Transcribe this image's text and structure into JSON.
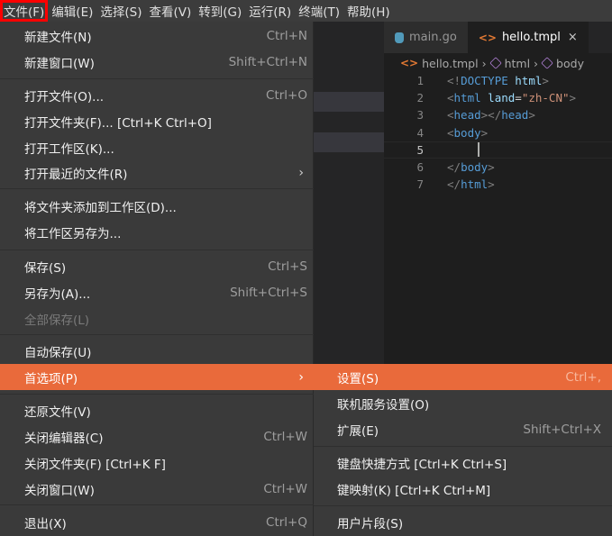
{
  "menubar": {
    "items": [
      "文件(F)",
      "编辑(E)",
      "选择(S)",
      "查看(V)",
      "转到(G)",
      "运行(R)",
      "终端(T)",
      "帮助(H)"
    ]
  },
  "tabs": [
    {
      "label": "main.go",
      "icon": "go-file-icon"
    },
    {
      "label": "hello.tmpl",
      "icon": "tag-file-icon",
      "close": "×"
    }
  ],
  "breadcrumb": {
    "file": "hello.tmpl",
    "html": "html",
    "body": "body"
  },
  "code": {
    "line_numbers": [
      "1",
      "2",
      "3",
      "4",
      "5",
      "6",
      "7"
    ],
    "l1_open": "<!",
    "l1_doctype": "DOCTYPE",
    "l1_sp": " ",
    "l1_html": "html",
    "l1_close": ">",
    "l2_open": "<",
    "l2_tag": "html",
    "l2_sp": " ",
    "l2_attr": "land",
    "l2_eq": "=",
    "l2_val": "\"zh-CN\"",
    "l2_close": ">",
    "l3_open": "<",
    "l3_tag": "head",
    "l3_mid": "></",
    "l3_tag2": "head",
    "l3_close": ">",
    "l4_open": "<",
    "l4_tag": "body",
    "l4_close": ">",
    "l6_open": "</",
    "l6_tag": "body",
    "l6_close": ">",
    "l7_open": "</",
    "l7_tag": "html",
    "l7_close": ">"
  },
  "file_menu": [
    {
      "label": "新建文件(N)",
      "shortcut": "Ctrl+N"
    },
    {
      "label": "新建窗口(W)",
      "shortcut": "Shift+Ctrl+N"
    },
    {
      "label": "打开文件(O)...",
      "shortcut": "Ctrl+O"
    },
    {
      "label": "打开文件夹(F)... [Ctrl+K Ctrl+O]",
      "shortcut": ""
    },
    {
      "label": "打开工作区(K)...",
      "shortcut": ""
    },
    {
      "label": "打开最近的文件(R)",
      "shortcut": ""
    },
    {
      "label": "将文件夹添加到工作区(D)...",
      "shortcut": ""
    },
    {
      "label": "将工作区另存为...",
      "shortcut": ""
    },
    {
      "label": "保存(S)",
      "shortcut": "Ctrl+S"
    },
    {
      "label": "另存为(A)...",
      "shortcut": "Shift+Ctrl+S"
    },
    {
      "label": "全部保存(L)",
      "shortcut": ""
    },
    {
      "label": "自动保存(U)",
      "shortcut": ""
    },
    {
      "label": "首选项(P)",
      "shortcut": ""
    },
    {
      "label": "还原文件(V)",
      "shortcut": ""
    },
    {
      "label": "关闭编辑器(C)",
      "shortcut": "Ctrl+W"
    },
    {
      "label": "关闭文件夹(F) [Ctrl+K F]",
      "shortcut": ""
    },
    {
      "label": "关闭窗口(W)",
      "shortcut": "Ctrl+W"
    },
    {
      "label": "退出(X)",
      "shortcut": "Ctrl+Q"
    }
  ],
  "arrow_glyph": "›",
  "preferences_submenu": [
    {
      "label": "设置(S)",
      "shortcut": "Ctrl+,"
    },
    {
      "label": "联机服务设置(O)",
      "shortcut": ""
    },
    {
      "label": "扩展(E)",
      "shortcut": "Shift+Ctrl+X"
    },
    {
      "label": "键盘快捷方式 [Ctrl+K Ctrl+S]",
      "shortcut": ""
    },
    {
      "label": "键映射(K) [Ctrl+K Ctrl+M]",
      "shortcut": ""
    },
    {
      "label": "用户片段(S)",
      "shortcut": ""
    }
  ],
  "colors": {
    "highlight": "#e96a3b",
    "menu_bg": "#3a3a3a",
    "active_menu_outline": "#ff0000"
  }
}
